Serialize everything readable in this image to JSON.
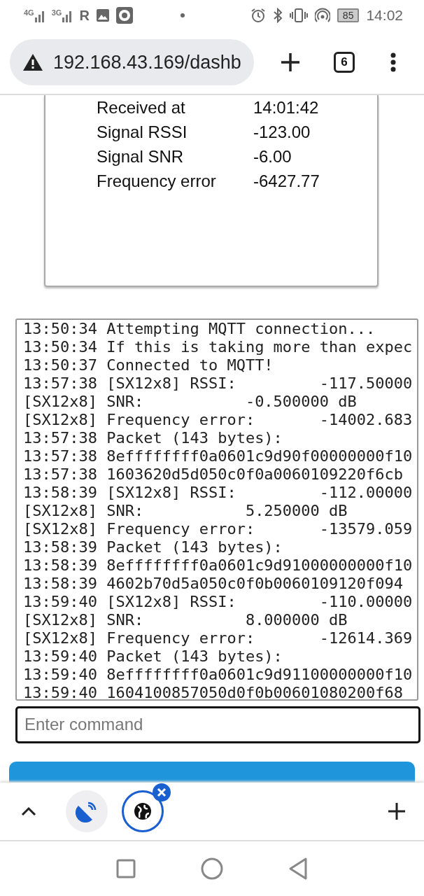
{
  "status_bar": {
    "networks": [
      "4G",
      "3G"
    ],
    "roaming": "R",
    "battery": "85",
    "time": "14:02"
  },
  "browser": {
    "url": "192.168.43.169/dashb",
    "tab_count": "6"
  },
  "packet_card": {
    "rows": [
      {
        "label": "Received at",
        "value": "14:01:42"
      },
      {
        "label": "Signal RSSI",
        "value": "-123.00"
      },
      {
        "label": "Signal SNR",
        "value": "-6.00"
      },
      {
        "label": "Frequency error",
        "value": "-6427.77"
      }
    ]
  },
  "console": {
    "lines": [
      "13:50:34 Attempting MQTT connection...",
      "13:50:34 If this is taking more than expec",
      "13:50:37 Connected to MQTT!",
      "13:57:38 [SX12x8] RSSI:         -117.50000",
      "[SX12x8] SNR:           -0.500000 dB",
      "[SX12x8] Frequency error:       -14002.683",
      "13:57:38 Packet (143 bytes):",
      "13:57:38 8effffffff0a0601c9d90f00000000f10",
      "13:57:38 1603620d5d050c0f0a0060109220f6cb",
      "13:58:39 [SX12x8] RSSI:         -112.00000",
      "[SX12x8] SNR:           5.250000 dB",
      "[SX12x8] Frequency error:       -13579.059",
      "13:58:39 Packet (143 bytes):",
      "13:58:39 8effffffff0a0601c9d91000000000f10",
      "13:58:39 4602b70d5a050c0f0b0060109120f094",
      "13:59:40 [SX12x8] RSSI:         -110.00000",
      "[SX12x8] SNR:           8.000000 dB",
      "[SX12x8] Frequency error:       -12614.369",
      "13:59:40 Packet (143 bytes):",
      "13:59:40 8effffffff0a0601c9d91100000000f10",
      "13:59:40 1604100857050d0f0b00601080200f68"
    ]
  },
  "command": {
    "placeholder": "Enter command"
  },
  "tab_strip": {
    "tabs": [
      {
        "kind": "dish",
        "selected": false
      },
      {
        "kind": "globe",
        "selected": true
      }
    ]
  }
}
